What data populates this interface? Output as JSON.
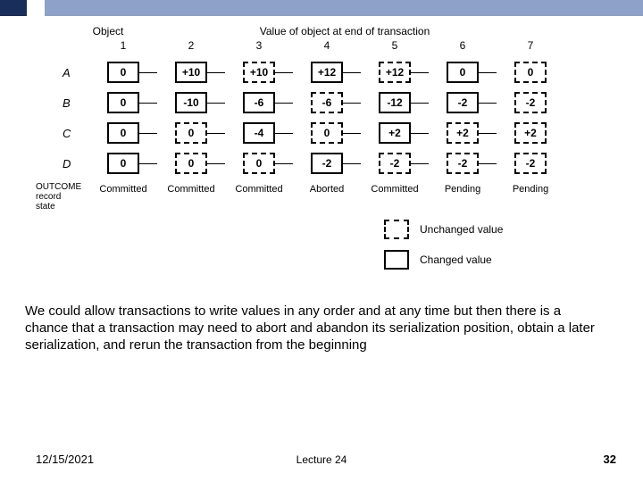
{
  "header": {
    "object_label": "Object",
    "value_label": "Value of object at end of transaction",
    "columns": [
      "1",
      "2",
      "3",
      "4",
      "5",
      "6",
      "7"
    ]
  },
  "rows": [
    {
      "name": "A",
      "cells": [
        {
          "v": "0",
          "style": "solid"
        },
        {
          "v": "+10",
          "style": "solid"
        },
        {
          "v": "+10",
          "style": "dashed"
        },
        {
          "v": "+12",
          "style": "solid"
        },
        {
          "v": "+12",
          "style": "dashed"
        },
        {
          "v": "0",
          "style": "solid"
        },
        {
          "v": "0",
          "style": "dashed"
        }
      ]
    },
    {
      "name": "B",
      "cells": [
        {
          "v": "0",
          "style": "solid"
        },
        {
          "v": "-10",
          "style": "solid"
        },
        {
          "v": "-6",
          "style": "solid"
        },
        {
          "v": "-6",
          "style": "dashed"
        },
        {
          "v": "-12",
          "style": "solid"
        },
        {
          "v": "-2",
          "style": "solid"
        },
        {
          "v": "-2",
          "style": "dashed"
        }
      ]
    },
    {
      "name": "C",
      "cells": [
        {
          "v": "0",
          "style": "solid"
        },
        {
          "v": "0",
          "style": "dashed"
        },
        {
          "v": "-4",
          "style": "solid"
        },
        {
          "v": "0",
          "style": "dashed"
        },
        {
          "v": "+2",
          "style": "solid"
        },
        {
          "v": "+2",
          "style": "dashed"
        },
        {
          "v": "+2",
          "style": "dashed"
        }
      ]
    },
    {
      "name": "D",
      "cells": [
        {
          "v": "0",
          "style": "solid"
        },
        {
          "v": "0",
          "style": "dashed"
        },
        {
          "v": "0",
          "style": "dashed"
        },
        {
          "v": "-2",
          "style": "solid"
        },
        {
          "v": "-2",
          "style": "dashed"
        },
        {
          "v": "-2",
          "style": "dashed"
        },
        {
          "v": "-2",
          "style": "dashed"
        }
      ]
    }
  ],
  "outcome_label_1": "OUTCOME",
  "outcome_label_2": "record",
  "outcome_label_3": "state",
  "states": [
    "Committed",
    "Committed",
    "Committed",
    "Aborted",
    "Committed",
    "Pending",
    "Pending"
  ],
  "legend": {
    "unchanged": "Unchanged value",
    "changed": "Changed value"
  },
  "body_text": "We could allow transactions to write values in any order and at any time but then there is a chance that a transaction may need to abort and abandon its serialization position, obtain a later serialization, and rerun the transaction from the beginning",
  "footer": {
    "date": "12/15/2021",
    "lecture": "Lecture 24",
    "page": "32"
  }
}
